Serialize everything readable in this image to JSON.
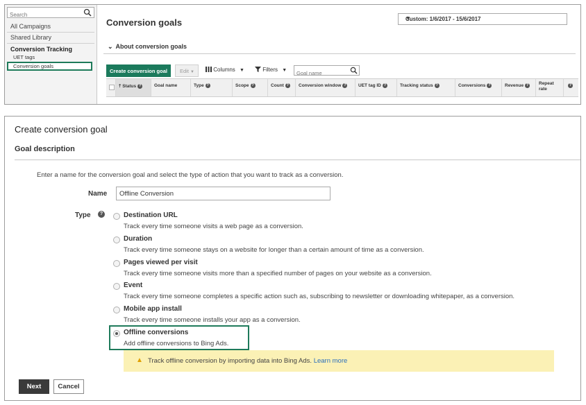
{
  "sidebar": {
    "search_placeholder": "Search",
    "items": [
      "All Campaigns",
      "Shared Library"
    ],
    "section_heading": "Conversion Tracking",
    "sub_items": [
      "UET tags",
      "Conversion goals"
    ]
  },
  "header": {
    "title": "Conversion goals",
    "date_range": "Custom: 1/6/2017 - 15/6/2017",
    "about_label": "About conversion goals"
  },
  "toolbar": {
    "create_label": "Create conversion goal",
    "edit_label": "Edit",
    "columns_label": "Columns",
    "filters_label": "Filters",
    "goal_search_placeholder": "Goal name"
  },
  "grid": {
    "columns": [
      "Status",
      "Goal name",
      "Type",
      "Scope",
      "Count",
      "Conversion window",
      "UET tag ID",
      "Tracking status",
      "Conversions",
      "Revenue",
      "Repeat rate"
    ]
  },
  "form": {
    "title": "Create conversion goal",
    "section": "Goal description",
    "intro": "Enter a name for the conversion goal and select the type of action that you want to track as a conversion.",
    "name_label": "Name",
    "name_value": "Offline Conversion",
    "type_label": "Type",
    "options": [
      {
        "title": "Destination URL",
        "desc": "Track every time someone visits a web page as a conversion.",
        "selected": false
      },
      {
        "title": "Duration",
        "desc": "Track every time someone stays on a website for longer than a certain amount of time as a conversion.",
        "selected": false
      },
      {
        "title": "Pages viewed per visit",
        "desc": "Track every time someone visits more than a specified number of pages on your website as a conversion.",
        "selected": false
      },
      {
        "title": "Event",
        "desc": "Track every time someone completes a specific action such as, subscribing to newsletter or downloading whitepaper, as a conversion.",
        "selected": false
      },
      {
        "title": "Mobile app install",
        "desc": "Track every time someone installs your app as a conversion.",
        "selected": false
      },
      {
        "title": "Offline conversions",
        "desc": "Add offline conversions to Bing Ads.",
        "selected": true
      }
    ],
    "notice_text": "Track offline conversion by importing data into Bing Ads.",
    "notice_link": "Learn more",
    "next_label": "Next",
    "cancel_label": "Cancel"
  },
  "colors": {
    "accent": "#1b7a5c",
    "highlight_border": "#1e7a5a",
    "notice_bg": "#fbf1b5",
    "warning": "#e0a000",
    "link": "#2a6ebb"
  },
  "icons": [
    "search-icon",
    "chevron-down-icon",
    "sort-up-icon",
    "help-icon",
    "columns-icon",
    "filter-icon",
    "warning-icon",
    "caret-down-icon"
  ]
}
